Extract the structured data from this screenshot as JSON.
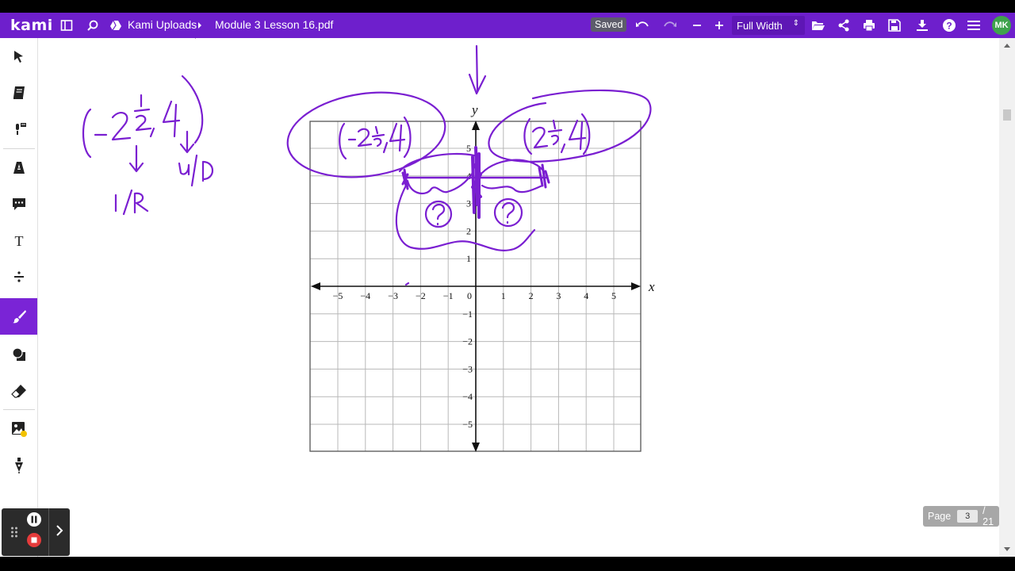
{
  "app": {
    "logo": "kami"
  },
  "toolbar": {
    "breadcrumb_folder": "Kami Uploads",
    "breadcrumb_file": "Module 3 Lesson 16.pdf",
    "saved_label": "Saved",
    "zoom_value": "Full Width",
    "avatar_initials": "MK",
    "icons": [
      "sidebar-toggle-icon",
      "search-icon",
      "drive-icon",
      "chevron-right-icon",
      "undo-icon",
      "redo-icon",
      "zoom-out-icon",
      "zoom-in-icon",
      "folder-open-icon",
      "share-icon",
      "print-icon",
      "save-icon",
      "download-icon",
      "help-icon",
      "menu-icon"
    ]
  },
  "sidebar": {
    "tools": [
      "select-tool",
      "dictionary-tool",
      "text-to-speech-tool",
      "highlighter-tool",
      "comment-tool",
      "text-tool",
      "equation-tool",
      "drawing-tool",
      "shapes-tool",
      "eraser-tool",
      "add-media-tool",
      "signature-tool"
    ],
    "active_tool": "drawing-tool"
  },
  "document": {
    "graph": {
      "x_axis_label": "x",
      "y_axis_label": "y",
      "x_ticks": [
        "−5",
        "−4",
        "−3",
        "−2",
        "−1",
        "0",
        "1",
        "2",
        "3",
        "4",
        "5"
      ],
      "y_ticks_pos": [
        "5",
        "4",
        "3",
        "2",
        "1"
      ],
      "y_ticks_neg": [
        "−1",
        "−2",
        "−3",
        "−4",
        "−5"
      ]
    },
    "ink_color": "#7a1fd1"
  },
  "pager": {
    "label": "Page",
    "current": "3",
    "total": "/ 21"
  },
  "recorder": {
    "controls": [
      "pause",
      "stop",
      "expand"
    ]
  }
}
